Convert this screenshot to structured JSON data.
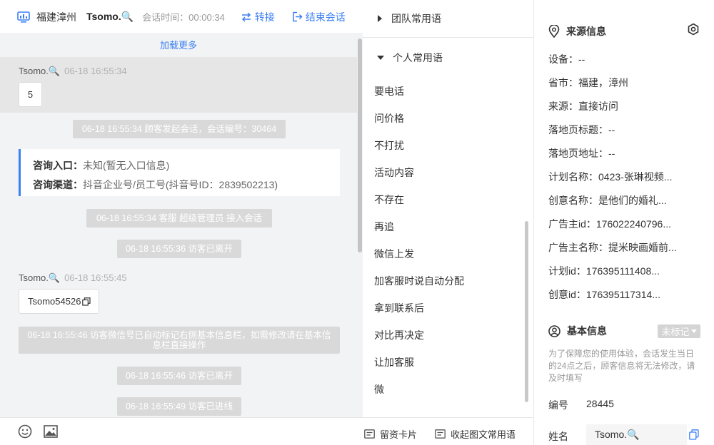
{
  "chat": {
    "header": {
      "location": "福建漳州",
      "visitor_name": "Tsomo.🔍",
      "session_time": "会话时间：00:00:34",
      "transfer_label": "转接",
      "end_label": "结束会话"
    },
    "load_more": "加载更多",
    "messages": [
      {
        "sender": "Tsomo.🔍",
        "time": "06-18 16:55:34",
        "text": "5"
      },
      {
        "sender": "Tsomo.🔍",
        "time": "06-18 16:55:45",
        "text": "Tsomo54526"
      }
    ],
    "system": [
      "06-18 16:55:34 顾客发起会话，会话编号：30464",
      "06-18 16:55:34 客服 超级管理员 接入会话",
      "06-18 16:55:36 访客已离开",
      "06-18 16:55:46 访客微信号已自动标记右侧基本信息栏，如需修改请在基本信息栏直接操作",
      "06-18 16:55:46 访客已离开",
      "06-18 16:55:49 访客已进线"
    ],
    "info_card": {
      "entry_label": "咨询入口：",
      "entry_value": "未知(暂无入口信息)",
      "channel_label": "咨询渠道：",
      "channel_value": "抖音企业号/员工号(抖音号ID：2839502213)"
    }
  },
  "phrases": {
    "team_group": "团队常用语",
    "personal_group": "个人常用语",
    "items": [
      "要电话",
      "问价格",
      "不打扰",
      "活动内容",
      "不存在",
      "再追",
      "微信上发",
      "加客服时说自动分配",
      "拿到联系后",
      "对比再决定",
      "让加客服",
      "微"
    ],
    "card_label": "留资卡片",
    "rich_label": "收起图文常用语"
  },
  "source_info": {
    "title": "来源信息",
    "rows": [
      "设备：--",
      "省市：福建，漳州",
      "来源：直接访问",
      "落地页标题：--",
      "落地页地址：--",
      "计划名称：0423-张琳视频...",
      "创意名称：是他们的婚礼...",
      "广告主id：176022240796...",
      "广告主名称：提米映画婚前...",
      "计划id：176395111408...",
      "创意id：176395117314..."
    ]
  },
  "basic_info": {
    "title": "基本信息",
    "badge": "未标记",
    "hint": "为了保障您的使用体验，会话发生当日的24点之后，顾客信息将无法修改，请及时填写",
    "number_label": "编号",
    "number_value": "28445",
    "name_label": "姓名",
    "name_value": "Tsomo.🔍"
  },
  "colors": {
    "accent": "#3b7ff5",
    "system_bg": "#d9d9d9",
    "chat_bg": "#f2f3f5"
  }
}
